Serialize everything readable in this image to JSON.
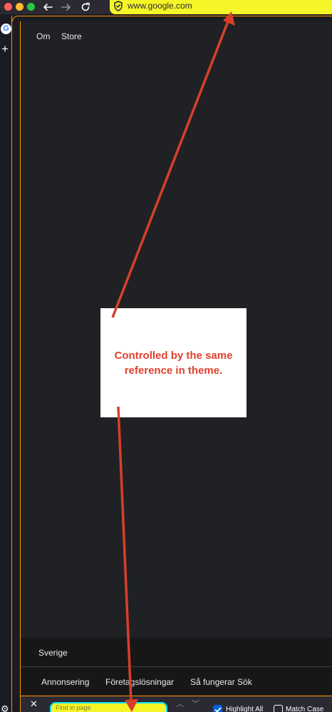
{
  "toolbar": {
    "url": "www.google.com",
    "url_bar_color": "#f5f527",
    "icons": [
      "close-window-icon",
      "minimize-window-icon",
      "maximize-window-icon",
      "back-arrow-icon",
      "forward-arrow-icon",
      "reload-icon",
      "tracking-protection-shield-icon"
    ]
  },
  "sidebar": {
    "icons": [
      "google-favicon-icon",
      "new-tab-plus-icon",
      "settings-gear-icon"
    ],
    "favicon_letter": "G"
  },
  "page": {
    "top_links": [
      "Om",
      "Store"
    ],
    "country": "Sverige",
    "footer_links": [
      "Annonsering",
      "Företagslösningar",
      "Så fungerar Sök"
    ]
  },
  "findbar": {
    "placeholder": "Find in page",
    "highlight_all_label": "Highlight All",
    "highlight_all_checked": true,
    "match_case_label": "Match Case",
    "match_case_checked": false
  },
  "annotation": {
    "text": "Controlled by the same reference in theme.",
    "color": "#e0412d"
  },
  "colors": {
    "frame_accent": "#ff9400",
    "find_input_fill": "#f5f527",
    "find_input_border": "#00ddff",
    "checkbox_checked": "#0060df"
  }
}
